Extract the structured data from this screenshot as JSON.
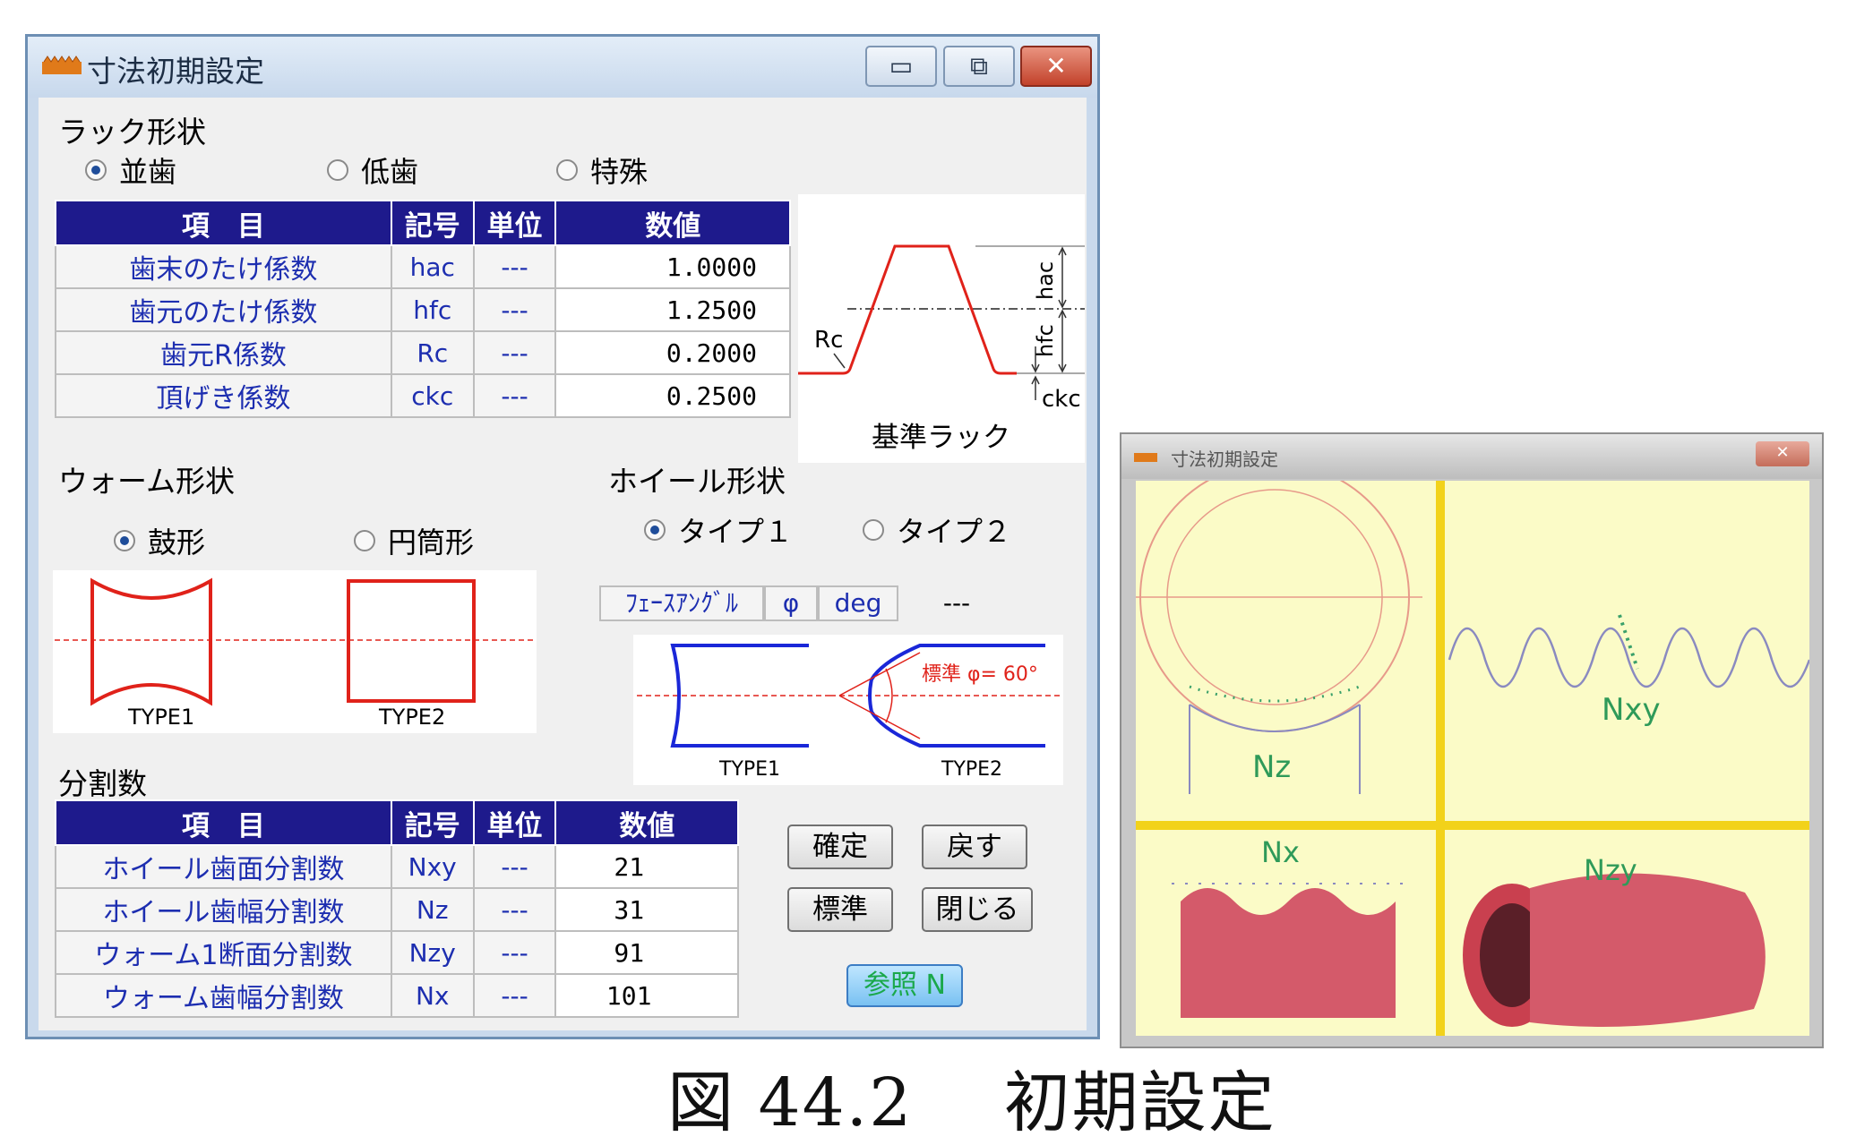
{
  "window": {
    "title": "寸法初期設定",
    "minimize_glyph": "▭",
    "restore_glyph": "⧉",
    "close_glyph": "✕"
  },
  "rack": {
    "section_label": "ラック形状",
    "options": [
      {
        "label": "並歯",
        "selected": true
      },
      {
        "label": "低歯",
        "selected": false
      },
      {
        "label": "特殊",
        "selected": false
      }
    ],
    "headers": [
      "項　目",
      "記号",
      "単位",
      "数値"
    ],
    "rows": [
      {
        "item": "歯末のたけ係数",
        "symbol": "hac",
        "unit": "---",
        "value": "1.0000"
      },
      {
        "item": "歯元のたけ係数",
        "symbol": "hfc",
        "unit": "---",
        "value": "1.2500"
      },
      {
        "item": "歯元R係数",
        "symbol": "Rc",
        "unit": "---",
        "value": "0.2000"
      },
      {
        "item": "頂げき係数",
        "symbol": "ckc",
        "unit": "---",
        "value": "0.2500"
      }
    ],
    "diagram": {
      "label_hac": "hac",
      "label_hfc": "hfc",
      "label_rc": "Rc",
      "label_ckc": "ckc",
      "caption": "基準ラック"
    }
  },
  "worm": {
    "section_label": "ウォーム形状",
    "options": [
      {
        "label": "鼓形",
        "selected": true
      },
      {
        "label": "円筒形",
        "selected": false
      }
    ],
    "type1_label": "TYPE1",
    "type2_label": "TYPE2"
  },
  "wheel": {
    "section_label": "ホイール形状",
    "options": [
      {
        "label": "タイプ１",
        "selected": true
      },
      {
        "label": "タイプ２",
        "selected": false
      }
    ],
    "face_angle_label": "ﾌｪｰｽｱﾝｸﾞﾙ",
    "face_angle_symbol": "φ",
    "face_angle_unit": "deg",
    "face_angle_value": "---",
    "type1_label": "TYPE1",
    "type2_label": "TYPE2",
    "standard_note": "標準 φ= 60°"
  },
  "divisions": {
    "section_label": "分割数",
    "headers": [
      "項　目",
      "記号",
      "単位",
      "数値"
    ],
    "rows": [
      {
        "item": "ホイール歯面分割数",
        "symbol": "Nxy",
        "unit": "---",
        "value": "21"
      },
      {
        "item": "ホイール歯幅分割数",
        "symbol": "Nz",
        "unit": "---",
        "value": "31"
      },
      {
        "item": "ウォーム1断面分割数",
        "symbol": "Nzy",
        "unit": "---",
        "value": "91"
      },
      {
        "item": "ウォーム歯幅分割数",
        "symbol": "Nx",
        "unit": "---",
        "value": "101"
      }
    ]
  },
  "buttons": {
    "confirm": "確定",
    "back": "戻す",
    "standard": "標準",
    "close": "閉じる",
    "reference": "参照 N"
  },
  "preview": {
    "title": "寸法初期設定",
    "close_glyph": "✕",
    "labels": {
      "nz": "Nz",
      "nxy": "Nxy",
      "nx": "Nx",
      "nzy": "Nzy"
    }
  },
  "caption": "図 44.2　 初期設定"
}
